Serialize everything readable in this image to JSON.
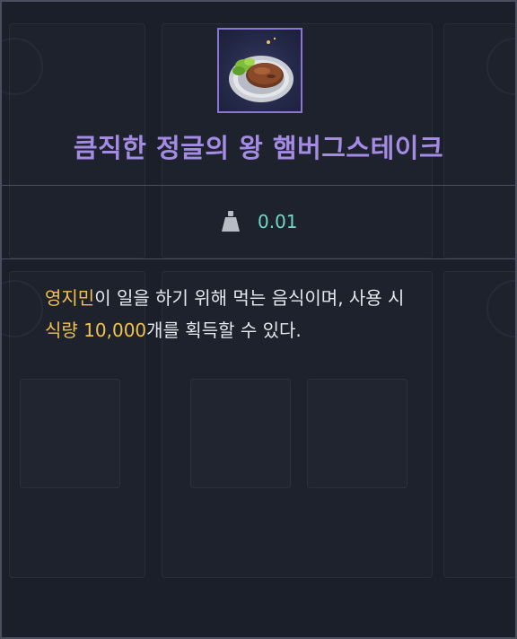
{
  "item": {
    "name": "큼직한 정글의 왕 햄버그스테이크",
    "icon": "hamburg-steak-icon",
    "weight": "0.01",
    "weight_icon": "weight-icon"
  },
  "description": {
    "part1_highlight": "영지민",
    "part1": "이 일을 하기 위해 먹는 음식이며, 사용 시",
    "part2_highlight": "식량 10,000",
    "part2": "개를 획득할 수 있다."
  },
  "colors": {
    "title": "#a48be4",
    "highlight": "#f2c14e",
    "weight": "#6fd8c8",
    "border": "#4a4f60",
    "icon_border": "#8a74d6"
  }
}
